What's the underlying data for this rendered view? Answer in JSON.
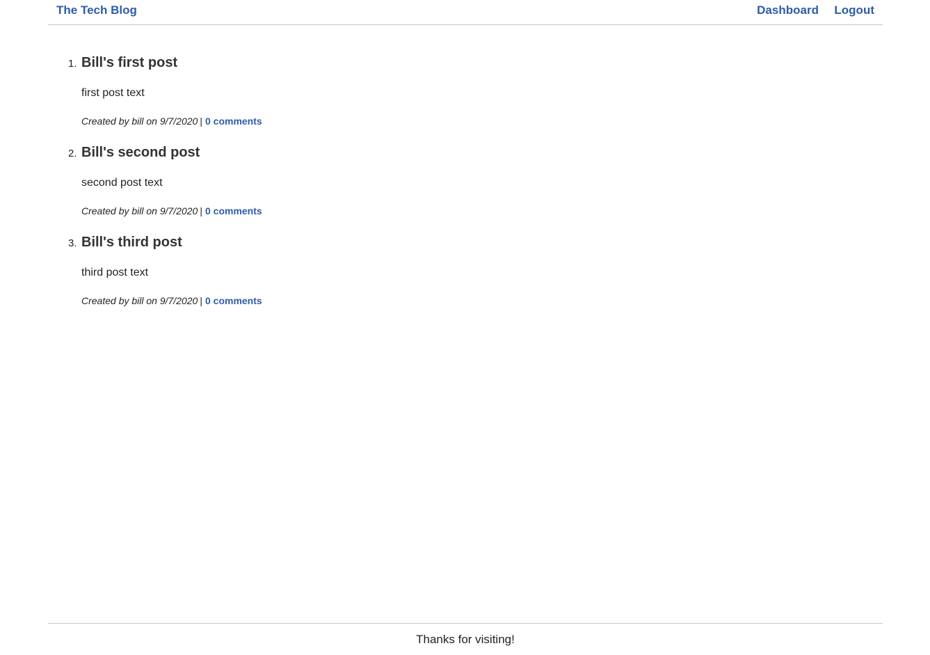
{
  "header": {
    "brand": "The Tech Blog",
    "nav": [
      {
        "label": "Dashboard"
      },
      {
        "label": "Logout"
      }
    ]
  },
  "posts": [
    {
      "number": "1.",
      "title": "Bill's first post",
      "body": "first post text",
      "meta": "Created by bill on 9/7/2020",
      "separator": "|",
      "comments": "0 comments"
    },
    {
      "number": "2.",
      "title": "Bill's second post",
      "body": "second post text",
      "meta": "Created by bill on 9/7/2020",
      "separator": "|",
      "comments": "0 comments"
    },
    {
      "number": "3.",
      "title": "Bill's third post",
      "body": "third post text",
      "meta": "Created by bill on 9/7/2020",
      "separator": "|",
      "comments": "0 comments"
    }
  ],
  "footer": {
    "text": "Thanks for visiting!"
  },
  "colors": {
    "link": "#2f5ca6",
    "text": "#222222",
    "divider": "#c8c8c8"
  }
}
